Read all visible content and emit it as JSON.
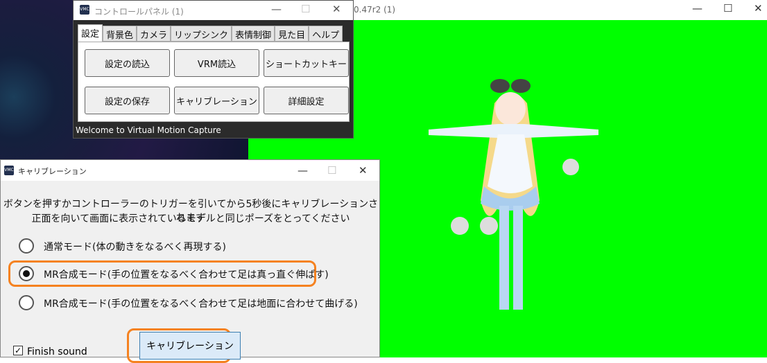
{
  "main_window": {
    "title": "0.47r2 (1)"
  },
  "control_panel": {
    "title": "コントロールパネル (1)",
    "tabs": [
      "設定",
      "背景色",
      "カメラ",
      "リップシンク",
      "表情制御",
      "見た目",
      "ヘルプ"
    ],
    "buttons": [
      "設定の読込",
      "VRM読込",
      "ショートカットキー",
      "設定の保存",
      "キャリブレーション",
      "詳細設定"
    ],
    "status": "Welcome to Virtual Motion Capture"
  },
  "calibration": {
    "title": "キャリブレーション",
    "message_line1": "ボタンを押すかコントローラーのトリガーを引いてから5秒後にキャリブレーションされます",
    "message_line2": "正面を向いて画面に表示されているモデルと同じポーズをとってください",
    "options": [
      {
        "label": "通常モード(体の動きをなるべく再現する)",
        "selected": false
      },
      {
        "label": "MR合成モード(手の位置をなるべく合わせて足は真っ直ぐ伸ばす)",
        "selected": true
      },
      {
        "label": "MR合成モード(手の位置をなるべく合わせて足は地面に合わせて曲げる)",
        "selected": false
      }
    ],
    "calibrate_button": "キャリブレーション",
    "finish_sound_label": "Finish sound",
    "finish_sound_checked": true
  },
  "colors": {
    "highlight": "#f58220",
    "green_screen": "#00ff00"
  }
}
